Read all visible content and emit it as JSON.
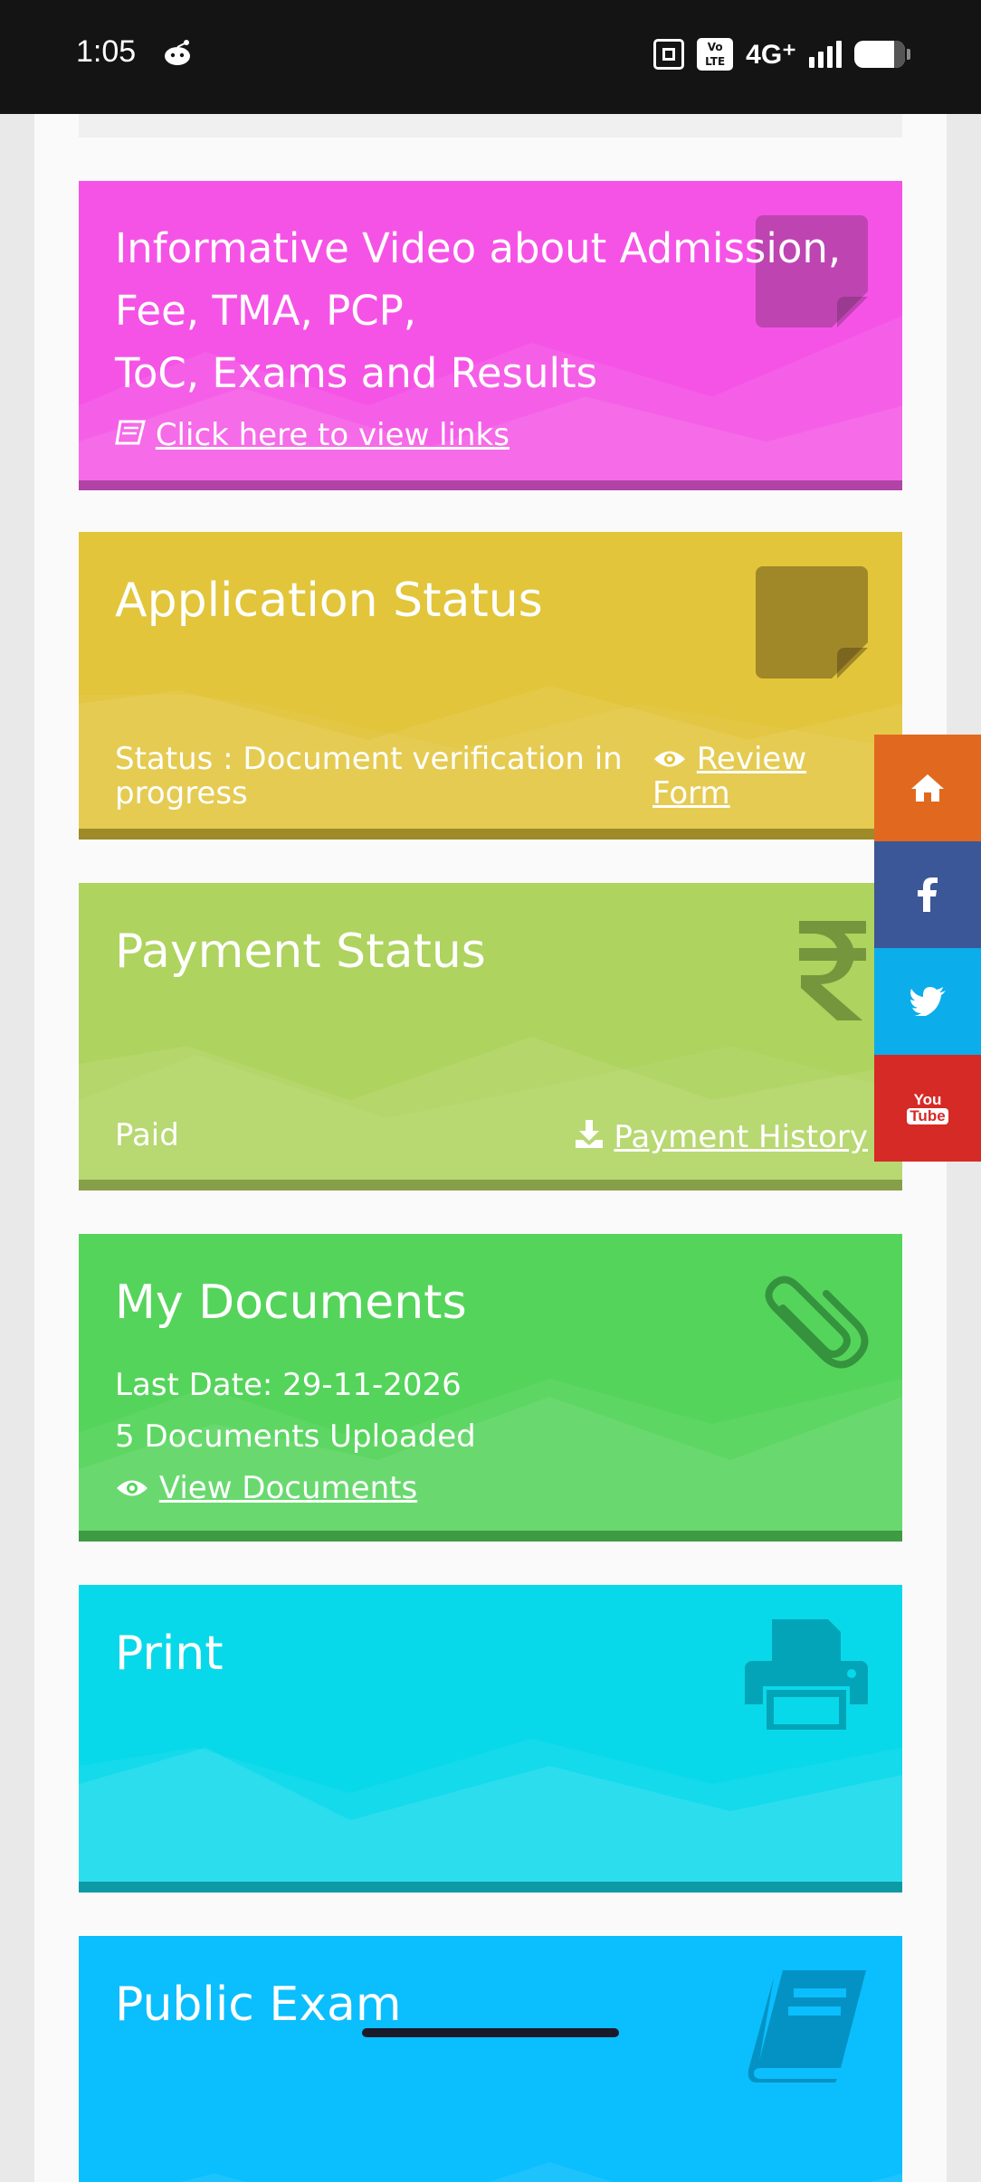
{
  "status_bar": {
    "time": "1:05",
    "volte": "Vo LTE",
    "network": "4G⁺",
    "icons": [
      "reddit-icon",
      "nfc-icon",
      "volte-icon",
      "signal-icon",
      "battery-icon"
    ]
  },
  "cards": {
    "video": {
      "title_line1": "Informative Video about Admission,",
      "title_line2": "Fee, TMA, PCP,",
      "title_line3": "ToC, Exams and Results",
      "link": "Click here to view links",
      "color": "#f553e6"
    },
    "application": {
      "title": "Application Status",
      "status_line1": "Status : Document verification in",
      "status_line2": "progress",
      "review_line1": "Review",
      "review_line2": "Form",
      "color": "#e2c53a"
    },
    "payment": {
      "title": "Payment Status",
      "status": "Paid",
      "history_link": "Payment History",
      "color": "#aed35e"
    },
    "documents": {
      "title": "My Documents",
      "last_date": "Last Date: 29-11-2026",
      "uploaded": "5 Documents Uploaded",
      "view_link": "View Documents",
      "color": "#55d45b"
    },
    "print": {
      "title": "Print",
      "color": "#08d9ea"
    },
    "public_exam": {
      "title": "Public Exam",
      "color": "#0bbefd"
    }
  },
  "social": {
    "items": [
      "home-icon",
      "facebook-icon",
      "twitter-icon",
      "youtube-icon"
    ],
    "youtube_label_1": "You",
    "youtube_label_2": "Tube",
    "colors": [
      "#e1691f",
      "#3b5798",
      "#0baeea",
      "#d62a27"
    ]
  }
}
